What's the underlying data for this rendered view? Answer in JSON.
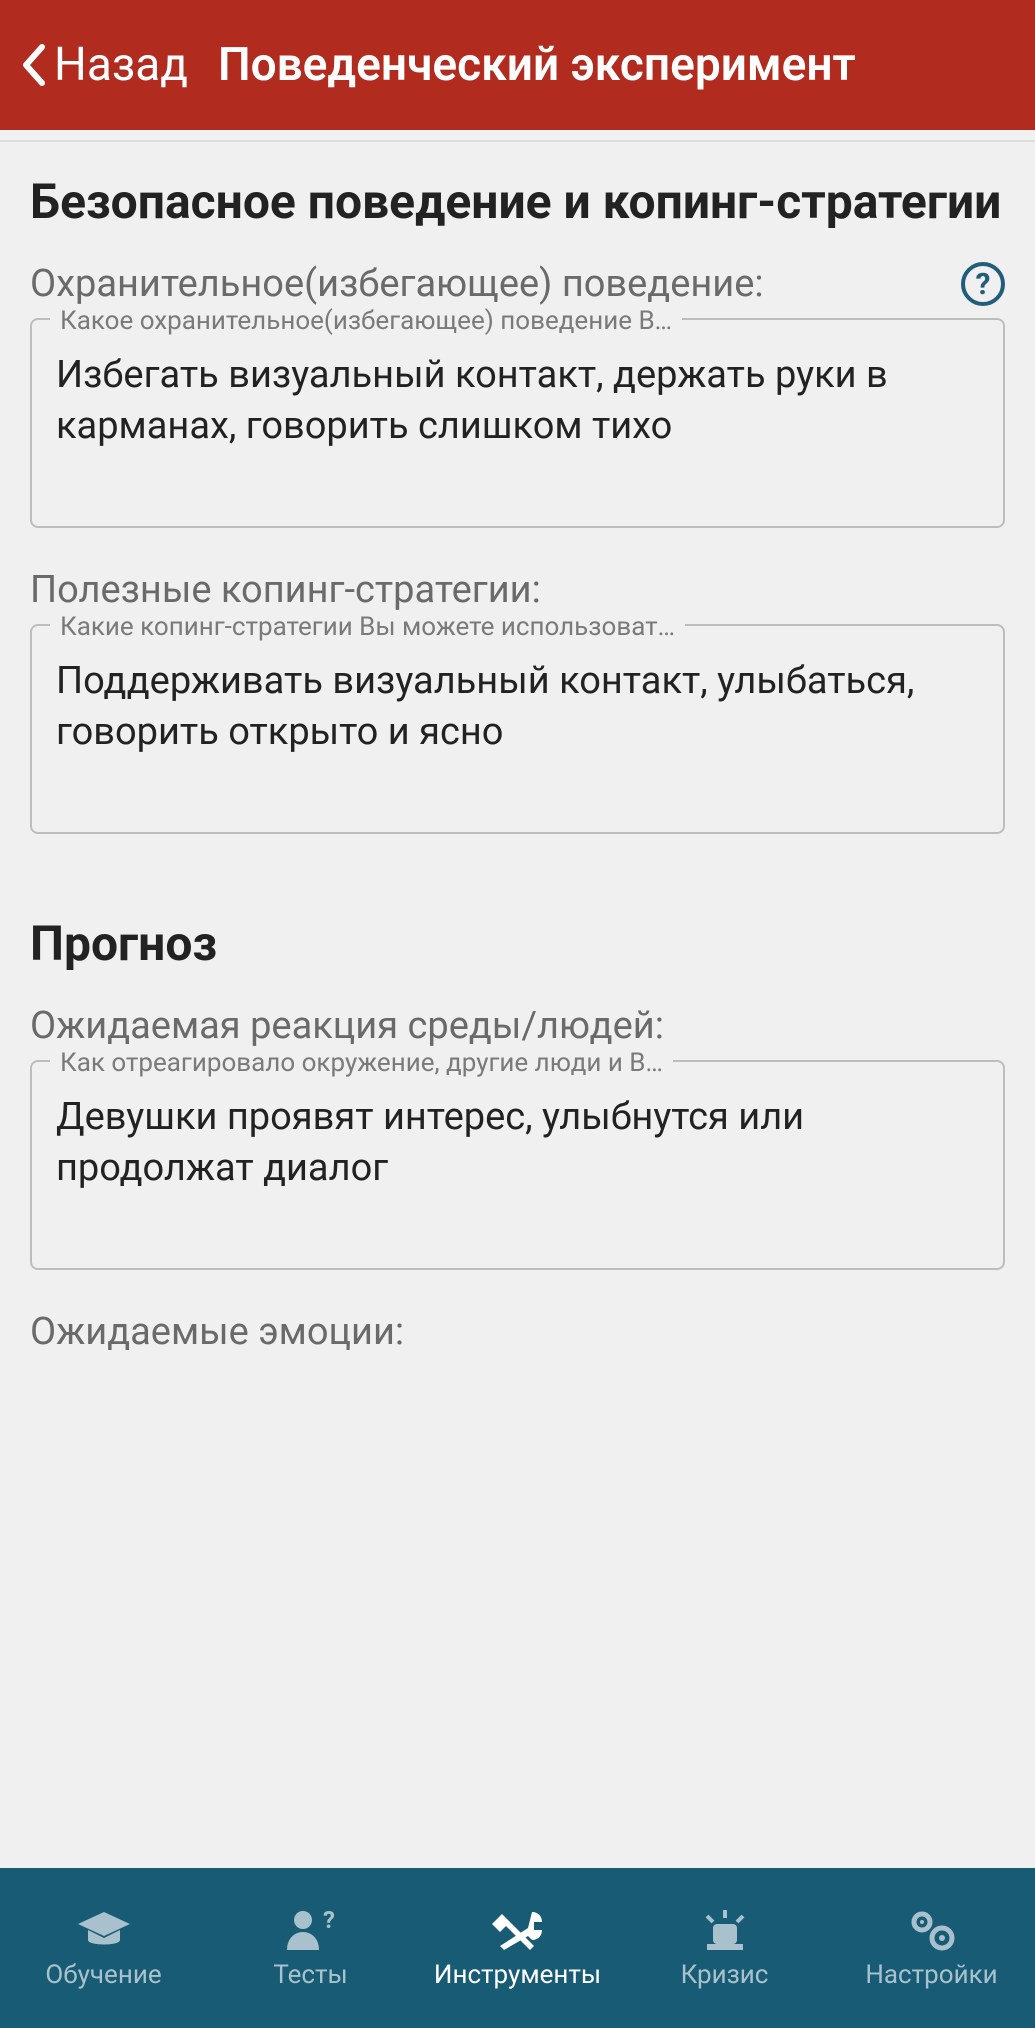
{
  "header": {
    "back_label": "Назад",
    "title": "Поведенческий эксперимент"
  },
  "sections": {
    "safety": {
      "title": "Безопасное поведение и копинг-стратегии",
      "protective": {
        "label": "Охранительное(избегающее) поведение:",
        "legend": "Какое охранительное(избегающее) поведение В…",
        "value": "Избегать визуальный контакт, держать руки в карманах, говорить слишком тихо"
      },
      "coping": {
        "label": "Полезные копинг-стратегии:",
        "legend": "Какие копинг-стратегии Вы можете использоват…",
        "value": "Поддерживать визуальный контакт, улыбаться, говорить открыто и ясно"
      }
    },
    "prognosis": {
      "title": "Прогноз",
      "reaction": {
        "label": "Ожидаемая реакция среды/людей:",
        "legend": "Как отреагировало окружение, другие люди и В…",
        "value": "Девушки проявят интерес, улыбнутся или продолжат диалог"
      },
      "emotions": {
        "label": "Ожидаемые эмоции:"
      }
    }
  },
  "help_icon_glyph": "?",
  "nav": {
    "items": [
      {
        "label": "Обучение"
      },
      {
        "label": "Тесты"
      },
      {
        "label": "Инструменты"
      },
      {
        "label": "Кризис"
      },
      {
        "label": "Настройки"
      }
    ],
    "active_index": 2
  }
}
